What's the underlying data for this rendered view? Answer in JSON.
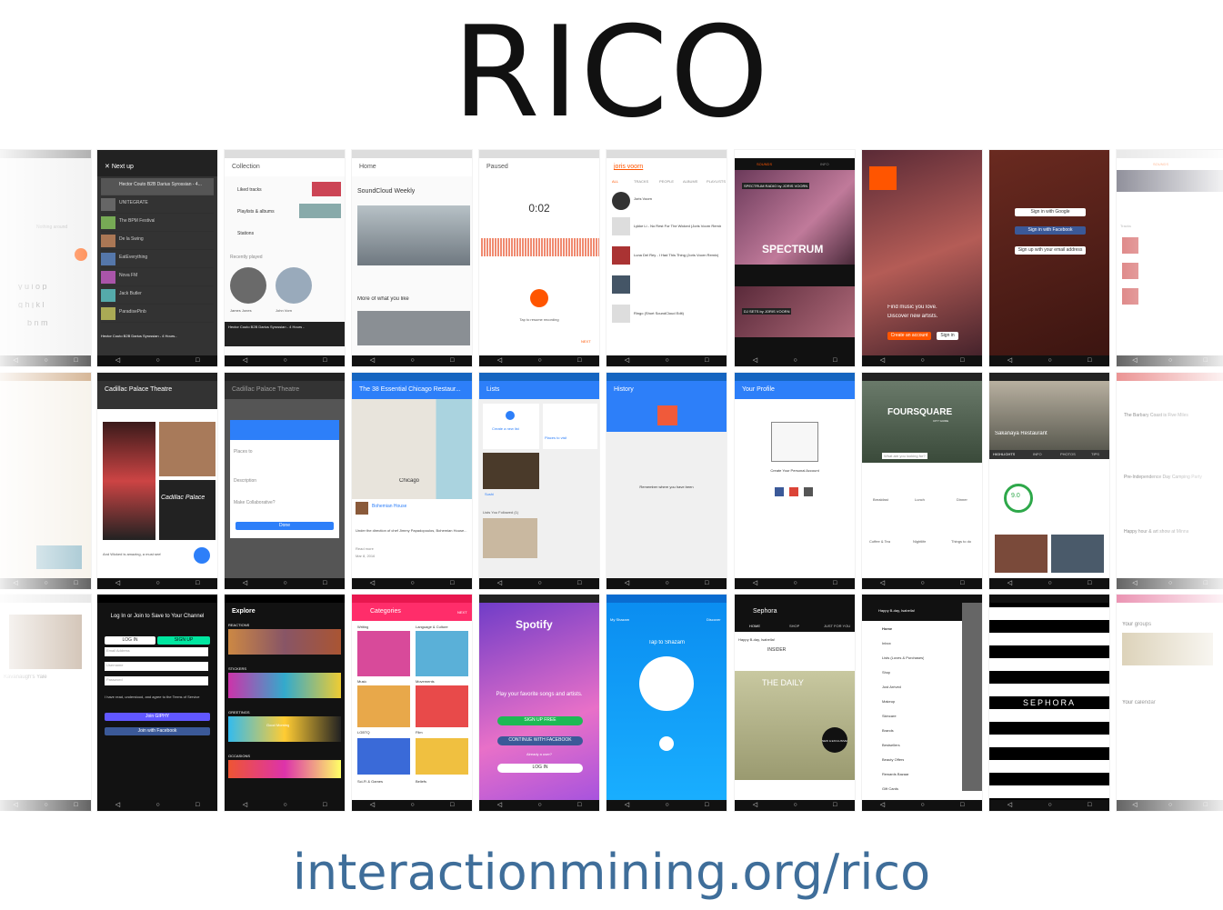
{
  "title": "RICO",
  "url": "interactionmining.org/rico",
  "nav_glyphs": {
    "back": "◁",
    "home": "○",
    "recent": "□"
  },
  "row1": {
    "p0": {
      "text1": "Nothing around",
      "keys1": "y u i o p",
      "keys2": "g h j k l",
      "keys3": "b n m"
    },
    "p1": {
      "title": "Next up",
      "items": [
        "Hector Couto B2B Darius Syrossian - 4...",
        "UNITEGRATE",
        "The BPM Festival",
        "De la Swing",
        "EatEverything",
        "Nova FM",
        "Jack Butler",
        "ParadisePinb"
      ],
      "now_playing": "Hector Couto B2B Darius Syrossian - 4 Hours..."
    },
    "p2": {
      "title": "Collection",
      "items": [
        "Liked tracks",
        "Playlists & albums",
        "Stations"
      ],
      "recent": "Recently played",
      "user1": "James Jones",
      "user2": "John Vorn",
      "now_playing": "Hector Couto B2B Darius Syrossian - 4 Hours -"
    },
    "p3": {
      "title": "Home",
      "header": "SoundCloud Weekly",
      "section": "More of what you like"
    },
    "p4": {
      "title": "Paused",
      "time": "0:02",
      "hint": "Tap to resume recording",
      "next": "NEXT"
    },
    "p5": {
      "query": "joris voorn",
      "tabs": [
        "ALL",
        "TRACKS",
        "PEOPLE",
        "ALBUMS",
        "PLAYLISTS"
      ],
      "items": [
        "Joris Voorn",
        "Lykke Li - No Rest For The Wicked (Joris Voorn Remix)",
        "Luna Del Rey - I Had This Thing (Joris Voorn Remix)",
        "Ringo (Short SoundCloud Edit)"
      ]
    },
    "p6": {
      "tabs": [
        "SOUNDS",
        "INFO"
      ],
      "banner": "SPECTRUM RADIO by JORIS VOORN",
      "logo": "SPECTRUM",
      "label2": "DJ SETS by JORIS VOORN"
    },
    "p7": {
      "line1": "Find music you love.",
      "line2": "Discover new artists.",
      "create": "Create an account",
      "signin": "Sign in"
    },
    "p8": {
      "google": "Sign in with Google",
      "facebook": "Sign in with Facebook",
      "email": "Sign up with your email address"
    },
    "p9": {
      "tabs": [
        "SOUNDS",
        "INFO"
      ],
      "tracks": "Tracks"
    }
  },
  "row2": {
    "p1": {
      "title": "Cadillac Palace Theatre",
      "tabs": [
        "HIGHLIGHTS",
        "INFO",
        "PHOTOS",
        "TIPS"
      ],
      "marquee": "Cadillac Palace",
      "caption": "And Wicked is amazing, a must see!"
    },
    "p2": {
      "title": "Cadillac Palace Theatre",
      "places": "Places to",
      "description": "Description",
      "collab": "Make Collaborative?",
      "done": "Done"
    },
    "p3": {
      "title": "The 38 Essential Chicago Restaur...",
      "city": "Chicago",
      "place": "Bohemian House",
      "desc": "Under the direction of chef Jimmy Papadopoulos, Bohemian House...",
      "more": "Read more",
      "date": "Mar 8, 2016"
    },
    "p4": {
      "title": "Lists",
      "create": "Create a new list",
      "places": "Places to visit",
      "sushi": "Sushi",
      "followed": "Lists You Followed (1)"
    },
    "p5": {
      "title": "History",
      "remember": "Remember where you have been"
    },
    "p6": {
      "title": "Your Profile",
      "create": "Create Your Personal Account"
    },
    "p7": {
      "logo": "FOURSQUARE",
      "sub": "CITY GUIDE",
      "search": "What are you looking for?",
      "cats": [
        "Breakfast",
        "Lunch",
        "Dinner",
        "Coffee & Tea",
        "Nightlife",
        "Things to do"
      ]
    },
    "p8": {
      "name": "Sakanaya Restaurant",
      "tabs": [
        "HIGHLIGHTS",
        "INFO",
        "PHOTOS",
        "TIPS"
      ],
      "score": "9.0"
    },
    "p9": {
      "line1": "The Barbary Coast is Five Miles",
      "line2": "Pre-Independence Day Camping Party",
      "line3": "Happy hour & art show at Minna"
    }
  },
  "row3": {
    "p0": {
      "name": "Kavanaugh's Yale"
    },
    "p1": {
      "title": "Log In or Join to Save to Your Channel",
      "login": "LOG IN",
      "signup": "SIGN UP",
      "email": "Email Address",
      "user": "Username",
      "pass": "Password",
      "agree": "I have read, understood, and agree to the Terms of Service",
      "giphy": "Join GIPHY",
      "facebook": "Join with Facebook"
    },
    "p2": {
      "title": "Explore",
      "sections": [
        "REACTIONS",
        "STICKERS",
        "GREETINGS",
        "OCCASIONS"
      ],
      "tags": [
        "Birthday",
        "Good Morning",
        "Good Night"
      ]
    },
    "p3": {
      "title": "Categories",
      "next": "NEXT",
      "cats": [
        "Writing",
        "Language & Culture",
        "Music",
        "Movements",
        "LGBTQ",
        "Film",
        "Sci-Fi & Games",
        "Beliefs"
      ]
    },
    "p4": {
      "logo": "Spotify",
      "tagline": "Play your favorite songs and artists.",
      "signup": "SIGN UP FREE",
      "facebook": "CONTINUE WITH FACEBOOK",
      "already": "Already a user?",
      "login": "LOG IN"
    },
    "p5": {
      "myshazam": "My Shazam",
      "discover": "Discover",
      "tap": "Tap to Shazam"
    },
    "p6": {
      "title": "Sephora",
      "tabs": [
        "HOME",
        "SHOP",
        "JUST FOR YOU"
      ],
      "greeting": "Happy B-day, Isabella!",
      "insider": "INSIDER",
      "daily": "THE DAILY",
      "new": "NEW & EXCLUSIVE!"
    },
    "p7": {
      "greeting": "Happy B-day, Isabella!",
      "menu": [
        "Home",
        "Inbox",
        "Lists (Loves & Purchases)",
        "Shop",
        "Just Arrived",
        "Makeup",
        "Skincare",
        "Brands",
        "Bestsellers",
        "Beauty Offers",
        "Rewards Bazaar",
        "Gift Cards"
      ]
    },
    "p8": {
      "logo": "SEPHORA"
    },
    "p9": {
      "groups": "Your groups",
      "calendar": "Your calendar"
    }
  },
  "colors": {
    "soundcloud_orange": "#ff5500",
    "foursquare_blue": "#2d7ff9",
    "url_blue": "#3f6e9a",
    "giphy_purple": "#9933ff",
    "spotify_green": "#1db954",
    "shazam_blue": "#0088ff",
    "dark": "#111111"
  }
}
